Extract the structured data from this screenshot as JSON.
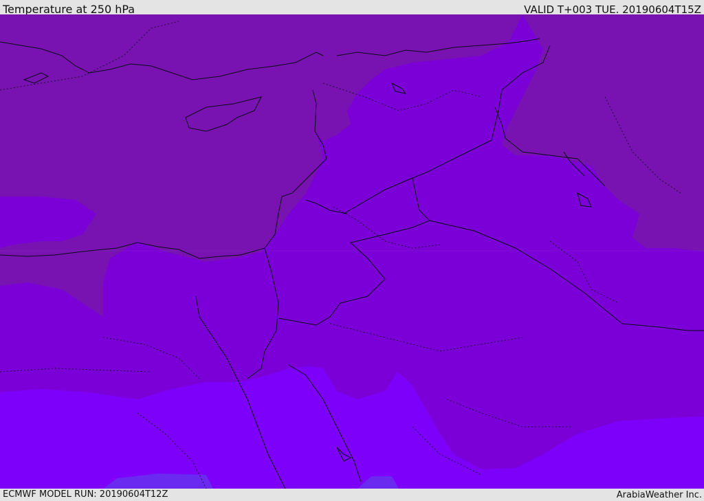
{
  "header": {
    "title": "Temperature at 250 hPa",
    "valid": "VALID T+003 TUE. 20190604T15Z"
  },
  "footer": {
    "model_run": "ECMWF MODEL RUN: 20190604T12Z",
    "credit": "ArabiaWeather Inc."
  },
  "colors": {
    "band_warm": "#7813b2",
    "band_mid": "#7b00d8",
    "band_cool": "#7d00fb",
    "band_cold": "#6a2af0",
    "boundary": "#0a0a14"
  }
}
